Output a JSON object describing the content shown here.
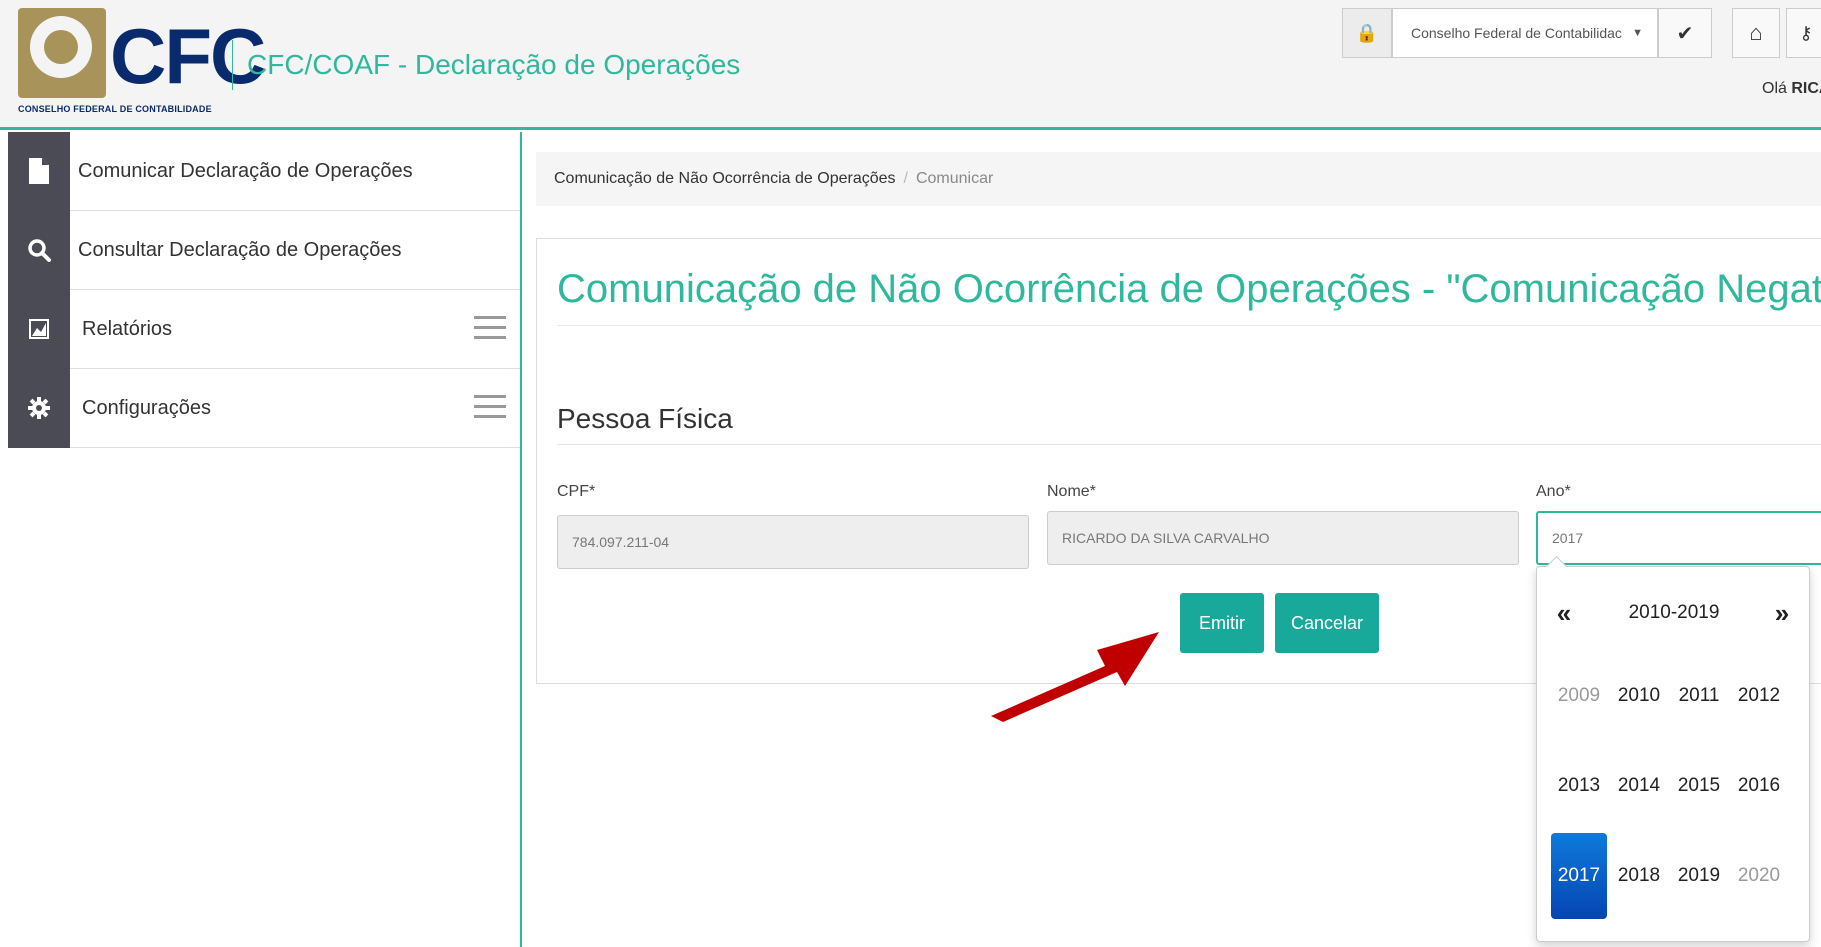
{
  "header": {
    "logo_text": "CFC",
    "logo_subtitle": "CONSELHO FEDERAL DE CONTABILIDADE",
    "app_title": "CFC/COAF - Declaração de Operações",
    "org_select_value": "Conselho Federal de Contabilidac",
    "greeting_prefix": "Olá",
    "greeting_name": "RICA"
  },
  "sidebar": {
    "items": [
      {
        "label": "Comunicar Declaração de Operações",
        "icon": "file-icon"
      },
      {
        "label": "Consultar Declaração de Operações",
        "icon": "search-icon"
      },
      {
        "label": "Relatórios",
        "icon": "chart-icon"
      },
      {
        "label": "Configurações",
        "icon": "gear-icon"
      }
    ]
  },
  "breadcrumb": {
    "parent": "Comunicação de Não Ocorrência de Operações",
    "separator": "/",
    "current": "Comunicar"
  },
  "main": {
    "page_title": "Comunicação de Não Ocorrência de Operações - \"Comunicação Negativa\"",
    "section_title": "Pessoa Física",
    "fields": {
      "cpf_label": "CPF*",
      "cpf_value": "784.097.211-04",
      "nome_label": "Nome*",
      "nome_value": "RICARDO DA SILVA CARVALHO",
      "ano_label": "Ano*",
      "ano_value": "2017"
    },
    "buttons": {
      "emit": "Emitir",
      "cancel": "Cancelar"
    }
  },
  "datepicker": {
    "prev": "«",
    "next": "»",
    "range": "2010-2019",
    "years": [
      "2009",
      "2010",
      "2011",
      "2012",
      "2013",
      "2014",
      "2015",
      "2016",
      "2017",
      "2018",
      "2019",
      "2020"
    ],
    "selected": "2017"
  },
  "colors": {
    "accent": "#2fb89c",
    "button": "#19a99a",
    "sidebar_icon_bg": "#4a4b55",
    "selected_year": "#0645b3",
    "arrow": "#c00000"
  }
}
